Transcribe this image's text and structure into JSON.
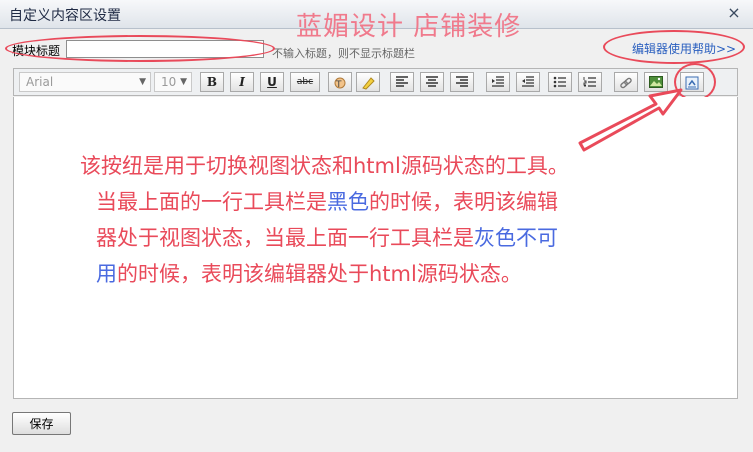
{
  "dialog": {
    "title": "自定义内容区设置",
    "close_glyph": "×"
  },
  "watermark": "蓝媚设计  店铺装修",
  "module_title": {
    "label": "模块标题",
    "value": "",
    "hint": "不输入标题，则不显示标题栏"
  },
  "help_link": "编辑器使用帮助>>",
  "toolbar": {
    "font_family": "Arial",
    "font_size": "10",
    "bold": "B",
    "italic": "I",
    "underline": "U",
    "strikethrough": "abc",
    "icons": [
      "font-color-icon",
      "highlight-icon",
      "align-left-icon",
      "align-center-icon",
      "align-right-icon",
      "outdent-icon",
      "indent-icon",
      "bullet-list-icon",
      "numbered-list-icon",
      "link-icon",
      "image-icon",
      "source-toggle-icon"
    ]
  },
  "annotation": {
    "line1_a": "该按纽是用于切换视图状态和html源码状态的工具。",
    "line2_a": "当最上面的一行工具栏是",
    "line2_b": "黑色",
    "line2_c": "的时候，表明该编辑",
    "line3_a": "器处于视图状态，当最上面一行工具栏是",
    "line3_b": "灰色不可",
    "line4_a": "用",
    "line4_b": "的时候，表明该编辑器处于html源码状态。"
  },
  "save_button": "保存",
  "colors": {
    "annotation_red": "#e94a5a",
    "annotation_blue": "#4a6ae0",
    "watermark_pink": "#f07a8c",
    "link_blue": "#2a5fbf"
  }
}
